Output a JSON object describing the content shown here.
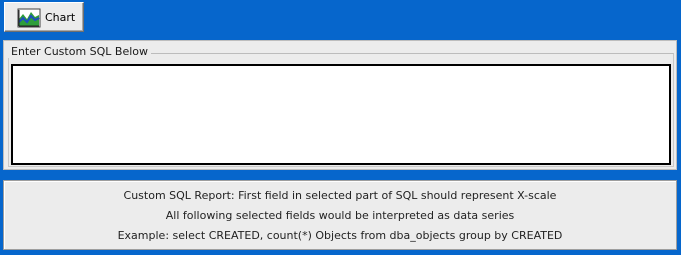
{
  "toolbar": {
    "chart_button": {
      "label": "Chart",
      "icon": "chart-icon"
    }
  },
  "sql_editor": {
    "legend": "Enter Custom SQL Below",
    "value": "",
    "placeholder": ""
  },
  "info": {
    "line1": "Custom SQL Report: First field in selected part of SQL should represent X-scale",
    "line2": "All following selected fields would be interpreted as data series",
    "line3": "Example: select CREATED, count(*) Objects from dba_objects group by CREATED"
  },
  "colors": {
    "background": "#0666cc",
    "panel": "#ececec",
    "chart_icon_green": "#2e9e3a",
    "chart_icon_blue": "#1d4fbf"
  }
}
